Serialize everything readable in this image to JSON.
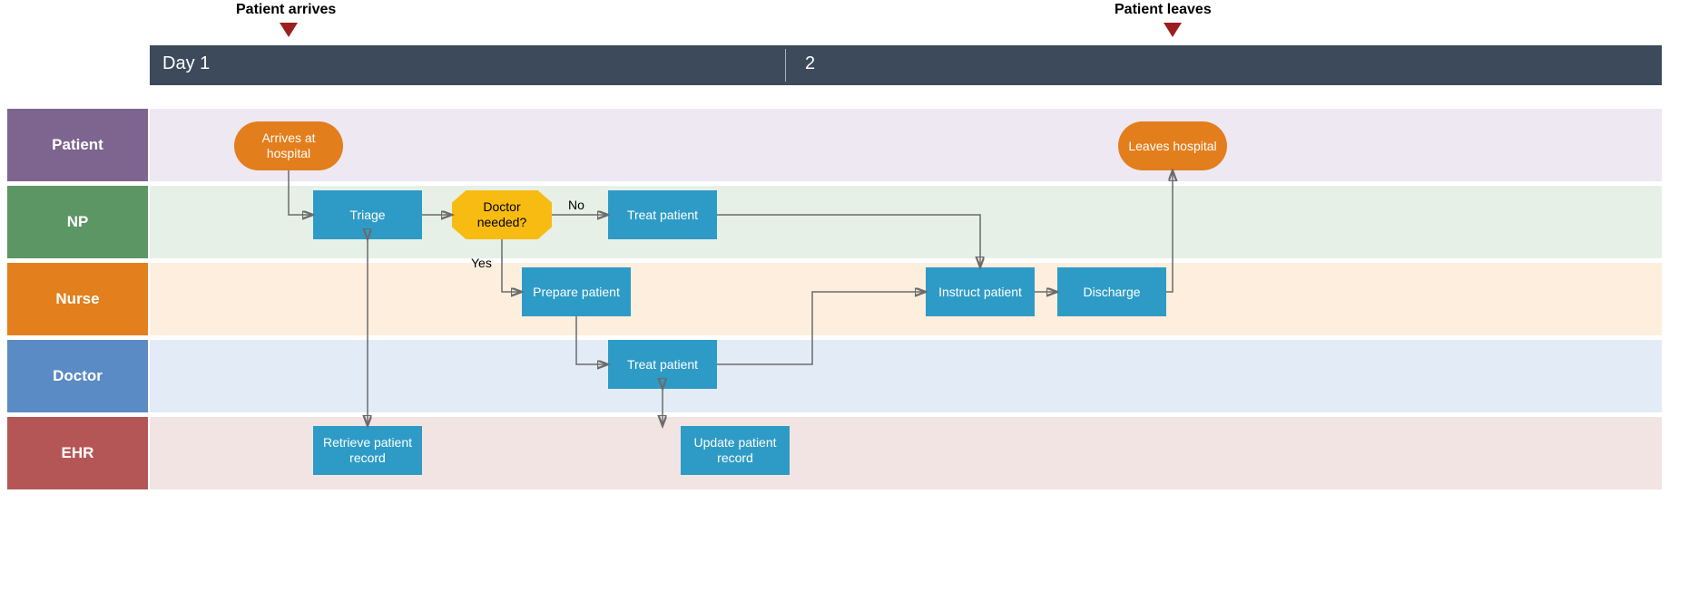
{
  "timeline": {
    "markers": [
      {
        "label": "Patient arrives"
      },
      {
        "label": "Patient leaves"
      }
    ],
    "segments": [
      {
        "label": "Day 1"
      },
      {
        "label": "2"
      }
    ]
  },
  "lanes": {
    "patient": "Patient",
    "np": "NP",
    "nurse": "Nurse",
    "doctor": "Doctor",
    "ehr": "EHR"
  },
  "nodes": {
    "arrives": "Arrives at hospital",
    "triage": "Triage",
    "decision": "Doctor needed?",
    "treat_np": "Treat patient",
    "prepare": "Prepare patient",
    "treat_dr": "Treat patient",
    "retrieve": "Retrieve patient record",
    "update": "Update patient record",
    "instruct": "Instruct patient",
    "discharge": "Discharge",
    "leaves": "Leaves hospital"
  },
  "edges": {
    "no": "No",
    "yes": "Yes"
  }
}
